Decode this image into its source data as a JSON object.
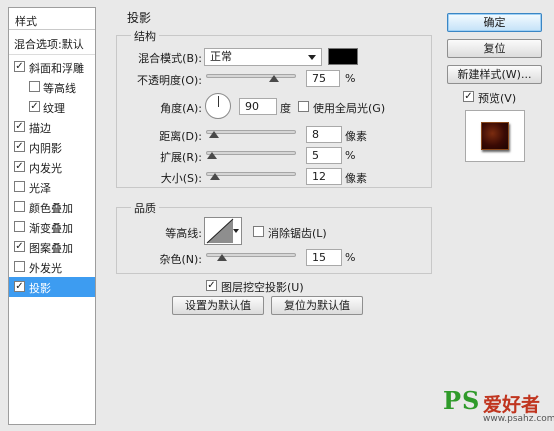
{
  "styles_panel": {
    "title": "样式",
    "blend_options": "混合选项:默认",
    "items": [
      {
        "label": "斜面和浮雕",
        "checked": true,
        "indent": false,
        "selected": false
      },
      {
        "label": "等高线",
        "checked": false,
        "indent": true,
        "selected": false
      },
      {
        "label": "纹理",
        "checked": true,
        "indent": true,
        "selected": false
      },
      {
        "label": "描边",
        "checked": true,
        "indent": false,
        "selected": false
      },
      {
        "label": "内阴影",
        "checked": true,
        "indent": false,
        "selected": false
      },
      {
        "label": "内发光",
        "checked": true,
        "indent": false,
        "selected": false
      },
      {
        "label": "光泽",
        "checked": false,
        "indent": false,
        "selected": false
      },
      {
        "label": "颜色叠加",
        "checked": false,
        "indent": false,
        "selected": false
      },
      {
        "label": "渐变叠加",
        "checked": false,
        "indent": false,
        "selected": false
      },
      {
        "label": "图案叠加",
        "checked": true,
        "indent": false,
        "selected": false
      },
      {
        "label": "外发光",
        "checked": false,
        "indent": false,
        "selected": false
      },
      {
        "label": "投影",
        "checked": true,
        "indent": false,
        "selected": true
      }
    ]
  },
  "section_title": "投影",
  "structure": {
    "title": "结构",
    "blend_mode_label": "混合模式(B):",
    "blend_mode_value": "正常",
    "shadow_color": "#000000",
    "opacity_label": "不透明度(O):",
    "opacity_value": "75",
    "opacity_unit": "%",
    "angle_label": "角度(A):",
    "angle_value": "90",
    "angle_unit": "度",
    "global_light_label": "使用全局光(G)",
    "global_light_checked": false,
    "distance_label": "距离(D):",
    "distance_value": "8",
    "distance_unit": "像素",
    "spread_label": "扩展(R):",
    "spread_value": "5",
    "spread_unit": "%",
    "size_label": "大小(S):",
    "size_value": "12",
    "size_unit": "像素"
  },
  "quality": {
    "title": "品质",
    "contour_label": "等高线:",
    "antialias_label": "消除锯齿(L)",
    "antialias_checked": false,
    "noise_label": "杂色(N):",
    "noise_value": "15",
    "noise_unit": "%"
  },
  "layer_knockout_label": "图层挖空投影(U)",
  "layer_knockout_checked": true,
  "make_default_label": "设置为默认值",
  "reset_default_label": "复位为默认值",
  "buttons": {
    "ok": "确定",
    "reset": "复位",
    "new_style": "新建样式(W)..."
  },
  "preview_label": "预览(V)",
  "preview_checked": true,
  "watermark": {
    "ps": "PS",
    "cn": "爱好者",
    "url": "www.psahz.com"
  },
  "colors": {
    "selected_row": "#3d9cf1",
    "primary_button_border": "#3b86c4"
  }
}
